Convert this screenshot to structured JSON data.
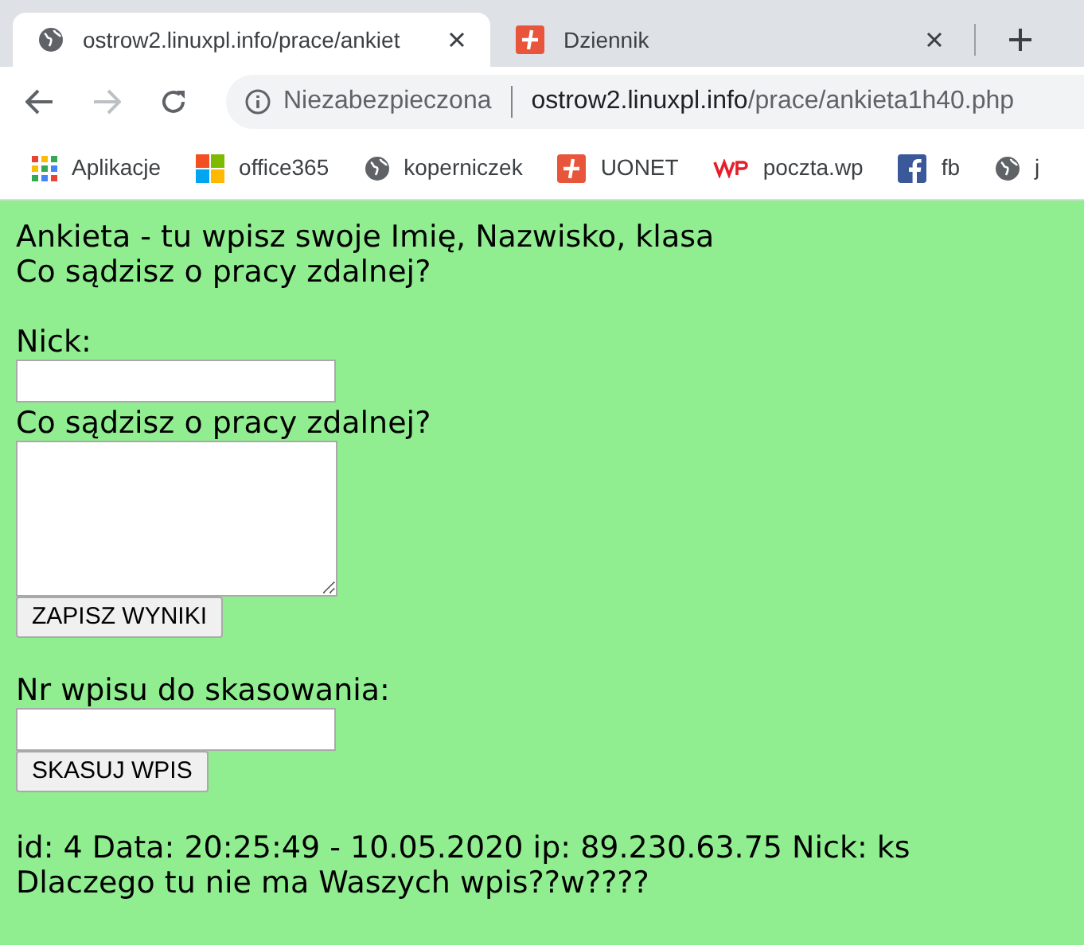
{
  "tabs": [
    {
      "title": "ostrow2.linuxpl.info/prace/ankiet",
      "kind": "globe",
      "selected": true
    },
    {
      "title": "Dziennik",
      "kind": "uonet",
      "selected": false
    }
  ],
  "address_bar": {
    "security": "Niezabezpieczona",
    "host": "ostrow2.linuxpl.info",
    "path": "/prace/ankieta1h40.php"
  },
  "bookmarks": [
    {
      "label": "Aplikacje",
      "kind": "apps"
    },
    {
      "label": "office365",
      "kind": "office"
    },
    {
      "label": "koperniczek",
      "kind": "globe"
    },
    {
      "label": "UONET",
      "kind": "uonet"
    },
    {
      "label": "poczta.wp",
      "kind": "wp"
    },
    {
      "label": "fb",
      "kind": "fb"
    },
    {
      "label": "j",
      "kind": "globe"
    }
  ],
  "page": {
    "heading_lines": [
      "Ankieta - tu wpisz swoje Imię, Nazwisko, klasa",
      "Co sądzisz o pracy zdalnej?"
    ],
    "nick_label": "Nick:",
    "opinion_label": "Co sądzisz o pracy zdalnej?",
    "save_button": "ZAPISZ WYNIKI",
    "delete_label": "Nr wpisu do skasowania:",
    "delete_button": "SKASUJ WPIS",
    "entries": [
      "id: 4 Data: 20:25:49 - 10.05.2020 ip: 89.230.63.75 Nick: ks",
      "Dlaczego tu nie ma Waszych wpis??w????"
    ]
  }
}
